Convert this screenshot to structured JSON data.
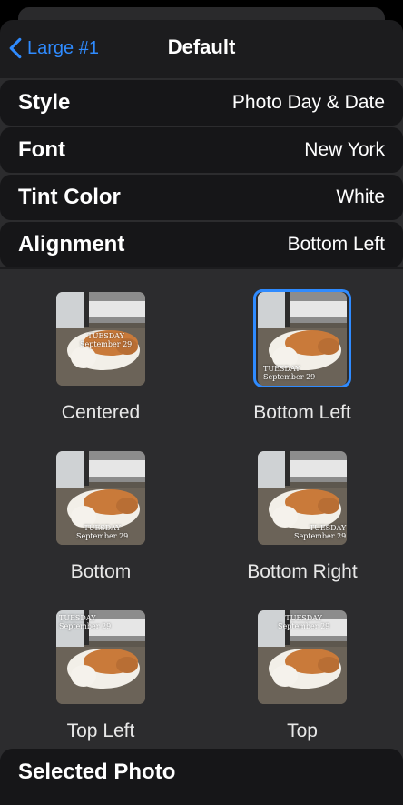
{
  "nav": {
    "back_label": "Large #1",
    "title": "Default"
  },
  "rows": [
    {
      "label": "Style",
      "value": "Photo Day & Date"
    },
    {
      "label": "Font",
      "value": "New York"
    },
    {
      "label": "Tint Color",
      "value": "White"
    },
    {
      "label": "Alignment",
      "value": "Bottom Left"
    }
  ],
  "options": [
    {
      "label": "Centered",
      "selected": false
    },
    {
      "label": "Bottom Left",
      "selected": true
    },
    {
      "label": "Bottom",
      "selected": false
    },
    {
      "label": "Bottom Right",
      "selected": false
    },
    {
      "label": "Top Left",
      "selected": false
    },
    {
      "label": "Top",
      "selected": false
    }
  ],
  "thumb_caption": {
    "day": "TUESDAY",
    "date": "September 29"
  },
  "bottom_section": {
    "label": "Selected Photo"
  },
  "colors": {
    "accent": "#2f8bff",
    "background": "#1c1c1e"
  }
}
